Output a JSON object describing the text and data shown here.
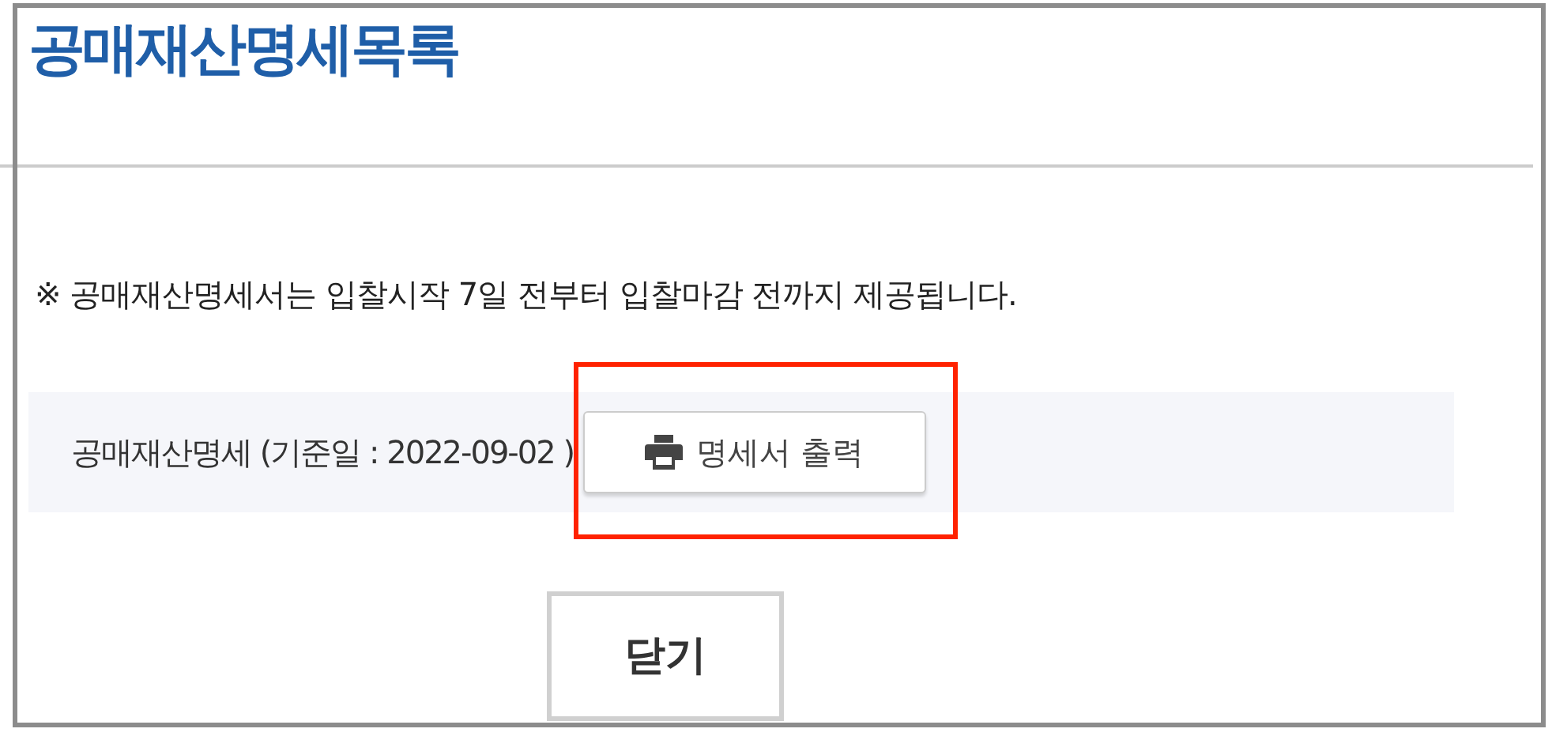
{
  "title": "공매재산명세목록",
  "notice": "※ 공매재산명세서는 입찰시작 7일 전부터 입찰마감 전까지 제공됩니다.",
  "statement": {
    "label": "공매재산명세 (기준일 : 2022-09-02 )",
    "button": "명세서 출력",
    "highlighted": true
  },
  "buttons": [
    "닫기"
  ]
}
